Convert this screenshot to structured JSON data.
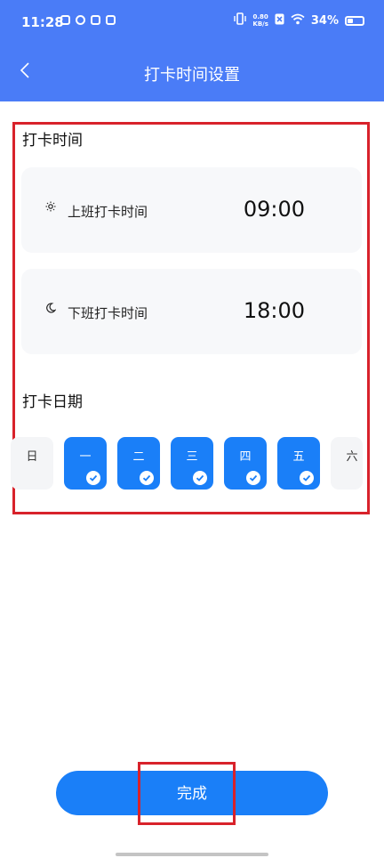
{
  "status_bar": {
    "time": "11:28",
    "net_speed_top": "0.80",
    "net_speed_bottom": "KB/s",
    "battery": "34%",
    "battery_level": 0.34
  },
  "nav": {
    "title": "打卡时间设置",
    "back_icon": "chevron-left-icon"
  },
  "section_time": {
    "title": "打卡时间",
    "cards": [
      {
        "icon": "sun-icon",
        "label": "上班打卡时间",
        "time": "09:00"
      },
      {
        "icon": "moon-icon",
        "label": "下班打卡时间",
        "time": "18:00"
      }
    ]
  },
  "section_days": {
    "title": "打卡日期",
    "days": [
      {
        "label": "日",
        "selected": false
      },
      {
        "label": "一",
        "selected": true
      },
      {
        "label": "二",
        "selected": true
      },
      {
        "label": "三",
        "selected": true
      },
      {
        "label": "四",
        "selected": true
      },
      {
        "label": "五",
        "selected": true
      },
      {
        "label": "六",
        "selected": false
      }
    ]
  },
  "footer": {
    "done_label": "完成"
  },
  "colors": {
    "header": "#4a7cf7",
    "accent": "#1a7ff8",
    "annotation": "#d8222b"
  }
}
